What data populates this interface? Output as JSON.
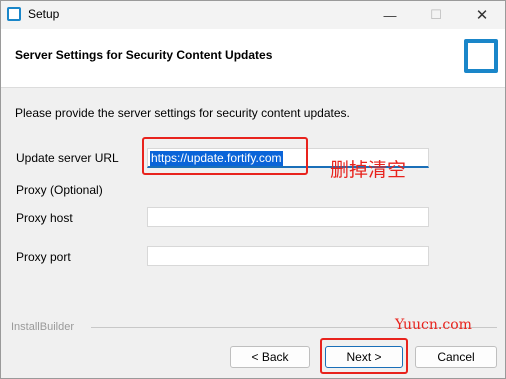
{
  "window": {
    "title": "Setup",
    "controls": {
      "minimize": "—",
      "maximize": "☐",
      "close": "✕"
    }
  },
  "header": {
    "title": "Server Settings for Security Content Updates"
  },
  "content": {
    "intro": "Please provide the server settings for security content updates.",
    "update_server_url": {
      "label": "Update server URL",
      "value": "https://update.fortify.com"
    },
    "proxy_section_label": "Proxy (Optional)",
    "proxy_host": {
      "label": "Proxy host",
      "value": ""
    },
    "proxy_port": {
      "label": "Proxy port",
      "value": ""
    }
  },
  "annotation": {
    "text": "删掉清空",
    "color": "#e8231d"
  },
  "footer": {
    "brand": "InstallBuilder",
    "watermark": "Yuucn.com",
    "buttons": {
      "back": "< Back",
      "next": "Next >",
      "cancel": "Cancel"
    }
  },
  "colors": {
    "accent": "#1a86c9",
    "selection": "#0a64d8",
    "annotation_red": "#e8231d"
  }
}
